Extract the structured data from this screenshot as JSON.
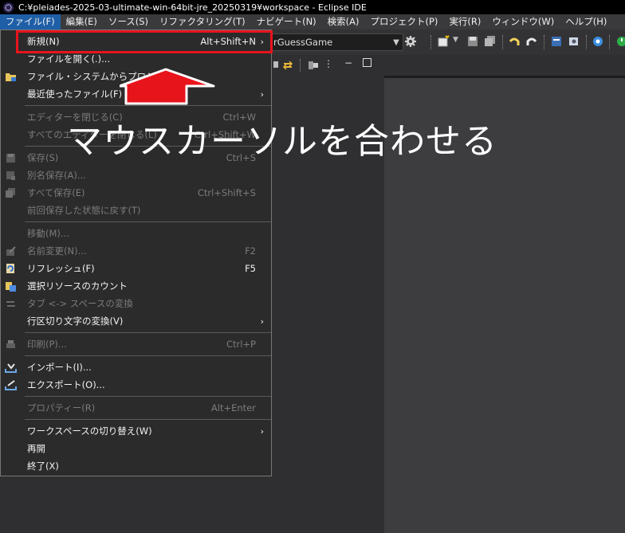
{
  "window": {
    "title": "C:¥pleiades-2025-03-ultimate-win-64bit-jre_20250319¥workspace - Eclipse IDE"
  },
  "menubar": [
    {
      "label": "ファイル(F)"
    },
    {
      "label": "編集(E)"
    },
    {
      "label": "ソース(S)"
    },
    {
      "label": "リファクタリング(T)"
    },
    {
      "label": "ナビゲート(N)"
    },
    {
      "label": "検索(A)"
    },
    {
      "label": "プロジェクト(P)"
    },
    {
      "label": "実行(R)"
    },
    {
      "label": "ウィンドウ(W)"
    },
    {
      "label": "ヘルプ(H)"
    }
  ],
  "toolbar": {
    "combo_value": "rGuessGame"
  },
  "file_menu": {
    "items": [
      {
        "label": "新規(N)",
        "accel": "Alt+Shift+N",
        "submenu": "›",
        "enabled": true
      },
      {
        "label": "ファイルを開く(.)...",
        "accel": "",
        "enabled": true
      },
      {
        "label": "ファイル・システムからプロジ",
        "accel": "",
        "enabled": true
      },
      {
        "label": "最近使ったファイル(F)",
        "accel": "",
        "submenu": "›",
        "enabled": true
      },
      {
        "label": "エディターを閉じる(C)",
        "accel": "Ctrl+W",
        "enabled": false
      },
      {
        "label": "すべてのエディターを閉じる(L)",
        "accel": "Ctrl+Shift+W",
        "enabled": false
      },
      {
        "label": "保存(S)",
        "accel": "Ctrl+S",
        "enabled": false
      },
      {
        "label": "別名保存(A)...",
        "accel": "",
        "enabled": false
      },
      {
        "label": "すべて保存(E)",
        "accel": "Ctrl+Shift+S",
        "enabled": false
      },
      {
        "label": "前回保存した状態に戻す(T)",
        "accel": "",
        "enabled": false
      },
      {
        "label": "移動(M)...",
        "accel": "",
        "enabled": false
      },
      {
        "label": "名前変更(N)...",
        "accel": "F2",
        "enabled": false
      },
      {
        "label": "リフレッシュ(F)",
        "accel": "F5",
        "enabled": true
      },
      {
        "label": "選択リソースのカウント",
        "accel": "",
        "enabled": true
      },
      {
        "label": "タブ <-> スペースの変換",
        "accel": "",
        "enabled": false
      },
      {
        "label": "行区切り文字の変換(V)",
        "accel": "",
        "submenu": "›",
        "enabled": true
      },
      {
        "label": "印刷(P)...",
        "accel": "Ctrl+P",
        "enabled": false
      },
      {
        "label": "インポート(I)...",
        "accel": "",
        "enabled": true
      },
      {
        "label": "エクスポート(O)...",
        "accel": "",
        "enabled": true
      },
      {
        "label": "プロパティー(R)",
        "accel": "Alt+Enter",
        "enabled": false
      },
      {
        "label": "ワークスペースの切り替え(W)",
        "accel": "",
        "submenu": "›",
        "enabled": true
      },
      {
        "label": "再開",
        "accel": "",
        "enabled": true
      },
      {
        "label": "終了(X)",
        "accel": "",
        "enabled": true
      }
    ]
  },
  "annotation": {
    "text": "マウスカーソルを合わせる",
    "highlight_color": "#e8141c"
  }
}
